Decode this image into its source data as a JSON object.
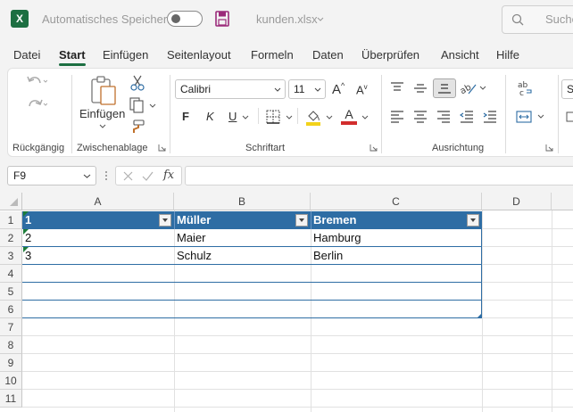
{
  "titlebar": {
    "autosave_label": "Automatisches Speichern",
    "filename": "kunden.xlsx",
    "search_placeholder": "Suche",
    "app_icon": "X"
  },
  "tabs": [
    "Datei",
    "Start",
    "Einfügen",
    "Seitenlayout",
    "Formeln",
    "Daten",
    "Überprüfen",
    "Ansicht",
    "Hilfe"
  ],
  "active_tab": "Start",
  "ribbon": {
    "groups": {
      "undo": "Rückgängig",
      "clipboard": "Zwischenablage",
      "font": "Schriftart",
      "alignment": "Ausrichtung"
    },
    "paste_label": "Einfügen",
    "font_name": "Calibri",
    "font_size": "11",
    "font_grow": "A",
    "font_shrink": "A",
    "bold": "F",
    "italic": "K",
    "underline": "U",
    "font_color": "A",
    "next_group_partial": "St"
  },
  "formula_bar": {
    "name_box": "F9",
    "fx": "fx",
    "value": ""
  },
  "columns": [
    "A",
    "B",
    "C",
    "D"
  ],
  "rows": [
    "1",
    "2",
    "3",
    "4",
    "5",
    "6",
    "7",
    "8",
    "9",
    "10",
    "11"
  ],
  "table": {
    "header": [
      "1",
      "Müller",
      "Bremen"
    ],
    "data": [
      [
        "2",
        "Maier",
        "Hamburg"
      ],
      [
        "3",
        "Schulz",
        "Berlin"
      ]
    ]
  },
  "colors": {
    "accent": "#1d6f42",
    "table_header": "#2e6da4"
  }
}
